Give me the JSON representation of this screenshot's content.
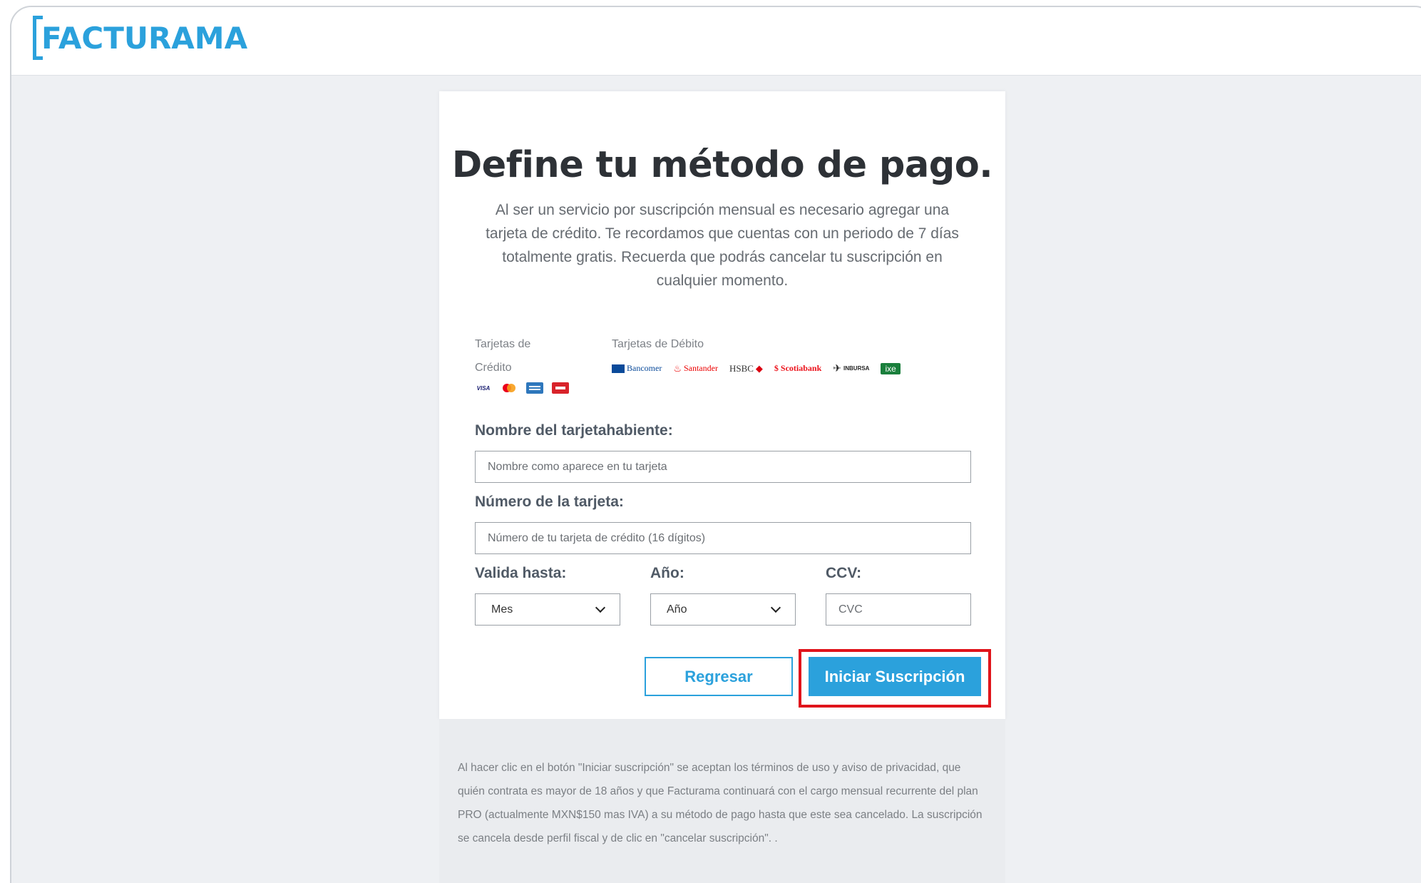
{
  "brand": {
    "logo_text": "FACTURAMA",
    "accent": "#2ba1dc"
  },
  "heading": {
    "title": "Define tu método de pago.",
    "description": "Al ser un servicio por suscripción mensual es necesario agregar una tarjeta de crédito. Te recordamos que cuentas con un periodo de 7 días totalmente gratis. Recuerda que podrás cancelar tu suscripción en cualquier momento."
  },
  "cards": {
    "credit_label_line1": "Tarjetas de",
    "credit_label_line2": "Crédito",
    "debit_label": "Tarjetas de Débito",
    "credit_logos": [
      {
        "text": "VISA",
        "color": "#1a1f71"
      },
      {
        "text": "",
        "color": "#eb001b"
      },
      {
        "text": "",
        "color": "#2e77bc"
      },
      {
        "text": "",
        "color": "#d8232a"
      }
    ],
    "debit_logos": [
      {
        "text": "Bancomer",
        "color": "#0a4a9a"
      },
      {
        "text": "Santander",
        "color": "#ec0000"
      },
      {
        "text": "HSBC",
        "color": "#333333"
      },
      {
        "text": "Scotiabank",
        "color": "#ec111a"
      },
      {
        "text": "INBURSA",
        "color": "#222222"
      },
      {
        "text": "ixe",
        "color": "#1a7f3c"
      }
    ]
  },
  "form": {
    "name_label": "Nombre del tarjetahabiente:",
    "name_placeholder": "Nombre como aparece en tu tarjeta",
    "number_label": "Número de la tarjeta:",
    "number_placeholder": "Número de tu tarjeta de crédito (16 dígitos)",
    "month_label": "Valida hasta:",
    "month_value": "Mes",
    "year_label": "Año:",
    "year_value": "Año",
    "ccv_label": "CCV:",
    "ccv_placeholder": "CVC"
  },
  "actions": {
    "back_label": "Regresar",
    "submit_label": "Iniciar Suscripción",
    "highlight_color": "#e0141b"
  },
  "legal": {
    "text": "Al hacer clic en el botón \"Iniciar suscripción\" se aceptan los términos de uso y aviso de privacidad, que quién contrata es mayor de 18 años y que Facturama continuará con el cargo mensual recurrente del plan PRO (actualmente MXN$150 mas IVA) a su método de pago hasta que este sea cancelado. La suscripción se cancela desde perfil fiscal y de clic en \"cancelar suscripción\". ."
  }
}
